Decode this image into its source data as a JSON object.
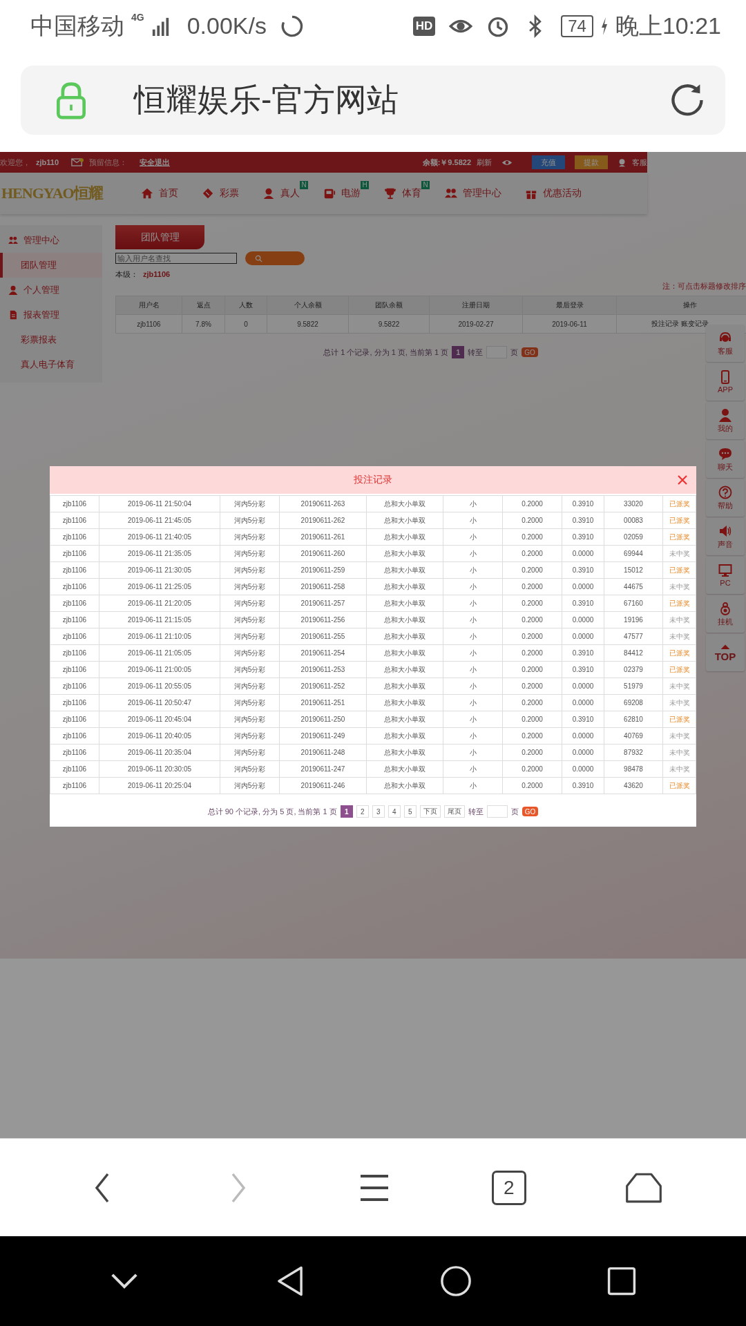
{
  "status_bar": {
    "carrier": "中国移动",
    "network": "4G",
    "speed": "0.00K/s",
    "hd": "HD",
    "battery": "74",
    "time": "晚上10:21"
  },
  "address_bar": {
    "title": "恒耀娱乐-官方网站"
  },
  "site": {
    "top_bar": {
      "welcome": "欢迎您，",
      "username": "zjb110",
      "message_label": "预留信息：",
      "logout": "安全退出",
      "balance": "余额:￥9.5822",
      "refresh": "刷新",
      "deposit": "充值",
      "withdraw": "提款",
      "service": "客服"
    },
    "logo": "HENGYAO恒耀",
    "nav": [
      {
        "label": "首页",
        "kind": "house"
      },
      {
        "label": "彩票",
        "kind": "ticket"
      },
      {
        "label": "真人",
        "kind": "dealer",
        "badge": "N"
      },
      {
        "label": "电游",
        "kind": "game",
        "badge": "H"
      },
      {
        "label": "体育",
        "kind": "trophy",
        "badge": "N"
      },
      {
        "label": "管理中心",
        "kind": "people"
      },
      {
        "label": "优惠活动",
        "kind": "gift"
      }
    ],
    "sidebar": [
      {
        "label": "管理中心",
        "kind": "people",
        "selected": false,
        "children": [
          {
            "label": "团队管理",
            "selected": true
          }
        ]
      },
      {
        "label": "个人管理",
        "kind": "person",
        "selected": false
      },
      {
        "label": "报表管理",
        "kind": "report",
        "selected": false,
        "children": [
          {
            "label": "彩票报表",
            "selected": false
          },
          {
            "label": "真人电子体育",
            "selected": false
          }
        ]
      }
    ],
    "tab": "团队管理",
    "search": {
      "placeholder": "输入用户名查找"
    },
    "level_label": "本级：",
    "level_user": "zjb1106",
    "note": "注：可点击标题修改排序",
    "table": {
      "columns": [
        "用户名",
        "返点",
        "人数",
        "个人余额",
        "团队余额",
        "注册日期",
        "最后登录",
        "操作"
      ],
      "rows": [
        {
          "cells": [
            "zjb1106",
            "7.8%",
            "0",
            "9.5822",
            "9.5822",
            "2019-02-27",
            "2019-06-11"
          ],
          "actions": [
            "投注记录",
            "账变记录"
          ]
        }
      ]
    },
    "pagination": {
      "summary": "总计 1 个记录, 分为 1 页, 当前第 1 页",
      "pages": [
        {
          "label": "1",
          "selected": true
        }
      ],
      "goto": "转至",
      "unit": "页",
      "go": "GO"
    },
    "float_menu": [
      {
        "label": "客服",
        "kind": "headset"
      },
      {
        "label": "APP",
        "kind": "phone"
      },
      {
        "label": "我的",
        "kind": "person"
      },
      {
        "label": "聊天",
        "kind": "chat"
      },
      {
        "label": "帮助",
        "kind": "help"
      },
      {
        "label": "声音",
        "kind": "speaker"
      },
      {
        "label": "PC",
        "kind": "monitor"
      },
      {
        "label": "挂机",
        "kind": "bag"
      },
      {
        "label": "TOP",
        "kind": "top"
      }
    ]
  },
  "modal": {
    "title": "投注记录",
    "rows": [
      {
        "cells": [
          "zjb1106",
          "2019-06-11 21:50:04",
          "河内5分彩",
          "20190611-263",
          "总和大小单双",
          "小",
          "0.2000",
          "0.3910",
          "33020",
          "已派奖"
        ],
        "won": true
      },
      {
        "cells": [
          "zjb1106",
          "2019-06-11 21:45:05",
          "河内5分彩",
          "20190611-262",
          "总和大小单双",
          "小",
          "0.2000",
          "0.3910",
          "00083",
          "已派奖"
        ],
        "won": true
      },
      {
        "cells": [
          "zjb1106",
          "2019-06-11 21:40:05",
          "河内5分彩",
          "20190611-261",
          "总和大小单双",
          "小",
          "0.2000",
          "0.3910",
          "02059",
          "已派奖"
        ],
        "won": true
      },
      {
        "cells": [
          "zjb1106",
          "2019-06-11 21:35:05",
          "河内5分彩",
          "20190611-260",
          "总和大小单双",
          "小",
          "0.2000",
          "0.0000",
          "69944",
          "未中奖"
        ],
        "won": false
      },
      {
        "cells": [
          "zjb1106",
          "2019-06-11 21:30:05",
          "河内5分彩",
          "20190611-259",
          "总和大小单双",
          "小",
          "0.2000",
          "0.3910",
          "15012",
          "已派奖"
        ],
        "won": true
      },
      {
        "cells": [
          "zjb1106",
          "2019-06-11 21:25:05",
          "河内5分彩",
          "20190611-258",
          "总和大小单双",
          "小",
          "0.2000",
          "0.0000",
          "44675",
          "未中奖"
        ],
        "won": false
      },
      {
        "cells": [
          "zjb1106",
          "2019-06-11 21:20:05",
          "河内5分彩",
          "20190611-257",
          "总和大小单双",
          "小",
          "0.2000",
          "0.3910",
          "67160",
          "已派奖"
        ],
        "won": true
      },
      {
        "cells": [
          "zjb1106",
          "2019-06-11 21:15:05",
          "河内5分彩",
          "20190611-256",
          "总和大小单双",
          "小",
          "0.2000",
          "0.0000",
          "19196",
          "未中奖"
        ],
        "won": false
      },
      {
        "cells": [
          "zjb1106",
          "2019-06-11 21:10:05",
          "河内5分彩",
          "20190611-255",
          "总和大小单双",
          "小",
          "0.2000",
          "0.0000",
          "47577",
          "未中奖"
        ],
        "won": false
      },
      {
        "cells": [
          "zjb1106",
          "2019-06-11 21:05:05",
          "河内5分彩",
          "20190611-254",
          "总和大小单双",
          "小",
          "0.2000",
          "0.3910",
          "84412",
          "已派奖"
        ],
        "won": true
      },
      {
        "cells": [
          "zjb1106",
          "2019-06-11 21:00:05",
          "河内5分彩",
          "20190611-253",
          "总和大小单双",
          "小",
          "0.2000",
          "0.3910",
          "02379",
          "已派奖"
        ],
        "won": true
      },
      {
        "cells": [
          "zjb1106",
          "2019-06-11 20:55:05",
          "河内5分彩",
          "20190611-252",
          "总和大小单双",
          "小",
          "0.2000",
          "0.0000",
          "51979",
          "未中奖"
        ],
        "won": false
      },
      {
        "cells": [
          "zjb1106",
          "2019-06-11 20:50:47",
          "河内5分彩",
          "20190611-251",
          "总和大小单双",
          "小",
          "0.2000",
          "0.0000",
          "69208",
          "未中奖"
        ],
        "won": false
      },
      {
        "cells": [
          "zjb1106",
          "2019-06-11 20:45:04",
          "河内5分彩",
          "20190611-250",
          "总和大小单双",
          "小",
          "0.2000",
          "0.3910",
          "62810",
          "已派奖"
        ],
        "won": true
      },
      {
        "cells": [
          "zjb1106",
          "2019-06-11 20:40:05",
          "河内5分彩",
          "20190611-249",
          "总和大小单双",
          "小",
          "0.2000",
          "0.0000",
          "40769",
          "未中奖"
        ],
        "won": false
      },
      {
        "cells": [
          "zjb1106",
          "2019-06-11 20:35:04",
          "河内5分彩",
          "20190611-248",
          "总和大小单双",
          "小",
          "0.2000",
          "0.0000",
          "87932",
          "未中奖"
        ],
        "won": false
      },
      {
        "cells": [
          "zjb1106",
          "2019-06-11 20:30:05",
          "河内5分彩",
          "20190611-247",
          "总和大小单双",
          "小",
          "0.2000",
          "0.0000",
          "98478",
          "未中奖"
        ],
        "won": false
      },
      {
        "cells": [
          "zjb1106",
          "2019-06-11 20:25:04",
          "河内5分彩",
          "20190611-246",
          "总和大小单双",
          "小",
          "0.2000",
          "0.3910",
          "43620",
          "已派奖"
        ],
        "won": true
      }
    ],
    "pagination": {
      "summary": "总计 90 个记录, 分为 5 页, 当前第 1 页",
      "pages": [
        {
          "label": "1",
          "selected": true
        },
        {
          "label": "2",
          "selected": false
        },
        {
          "label": "3",
          "selected": false
        },
        {
          "label": "4",
          "selected": false
        },
        {
          "label": "5",
          "selected": false
        }
      ],
      "next": "下页",
      "last": "尾页",
      "goto": "转至",
      "unit": "页",
      "go": "GO"
    }
  },
  "browser_toolbar": {
    "tab_count": "2"
  }
}
